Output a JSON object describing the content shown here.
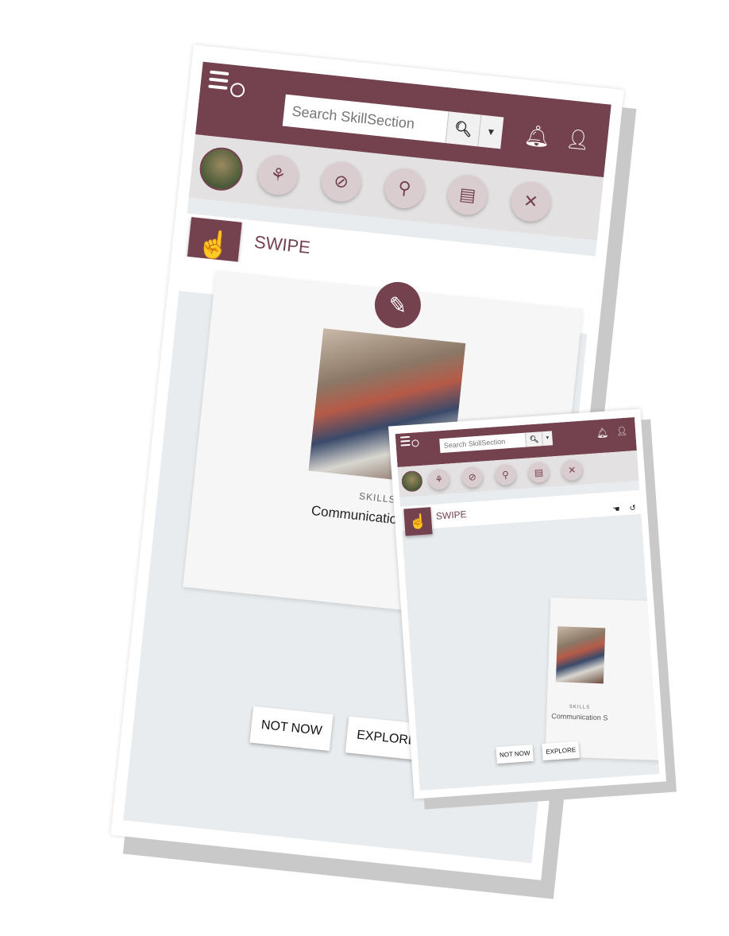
{
  "search": {
    "placeholder": "Search SkillSection"
  },
  "header": {
    "menu_icon": "hamburger-icon",
    "search_icon": "magnifier-icon",
    "dropdown_icon": "caret-down-icon",
    "bell_icon": "bell-icon",
    "user_icon": "user-icon"
  },
  "nav": {
    "items": [
      {
        "icon": "org-chart-icon",
        "glyph": "⚘"
      },
      {
        "icon": "compass-icon",
        "glyph": "⊘"
      },
      {
        "icon": "wrench-key-icon",
        "glyph": "⚲"
      },
      {
        "icon": "toolbox-icon",
        "glyph": "▤"
      },
      {
        "icon": "tools-icon",
        "glyph": "✕"
      }
    ]
  },
  "section": {
    "title": "SWIPE"
  },
  "card": {
    "category": "SKILLS",
    "title": "Communication Skills",
    "small_title": "Communication S"
  },
  "buttons": {
    "not_now": "NOT NOW",
    "explore": "EXPLORE"
  },
  "colors": {
    "brand": "#74414f",
    "background": "#e9ecee"
  }
}
